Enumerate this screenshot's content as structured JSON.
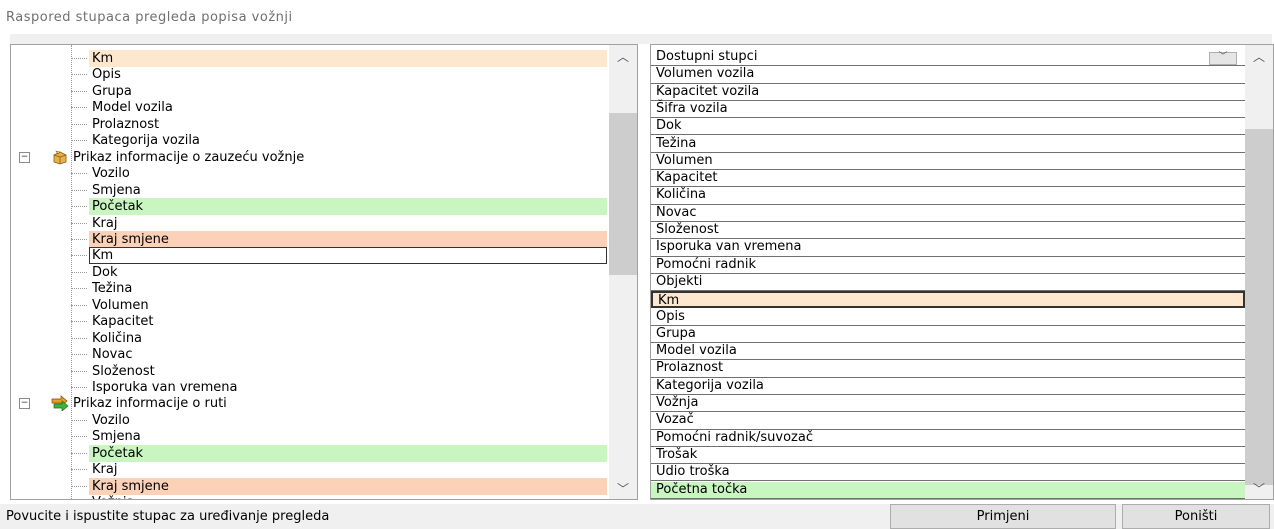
{
  "title": "Raspored stupaca pregleda popisa vožnji",
  "colors": {
    "peach": "#fde8cf",
    "salmon": "#fbd2b8",
    "green": "#c8f5c0",
    "selected_border": "#333333"
  },
  "tree": {
    "items": [
      {
        "label": "Km",
        "type": "leaf",
        "highlight": "peach"
      },
      {
        "label": "Opis",
        "type": "leaf"
      },
      {
        "label": "Grupa",
        "type": "leaf"
      },
      {
        "label": "Model vozila",
        "type": "leaf"
      },
      {
        "label": "Prolaznost",
        "type": "leaf"
      },
      {
        "label": "Kategorija vozila",
        "type": "leaf"
      },
      {
        "label": "Prikaz informacije o zauzeću vožnje",
        "type": "group",
        "icon": "package-icon",
        "expander": "−"
      },
      {
        "label": "Vozilo",
        "type": "leaf"
      },
      {
        "label": "Smjena",
        "type": "leaf"
      },
      {
        "label": "Početak",
        "type": "leaf",
        "highlight": "green"
      },
      {
        "label": "Kraj",
        "type": "leaf"
      },
      {
        "label": "Kraj smjene",
        "type": "leaf",
        "highlight": "salmon"
      },
      {
        "label": "Km",
        "type": "leaf",
        "selected": true
      },
      {
        "label": "Dok",
        "type": "leaf"
      },
      {
        "label": "Težina",
        "type": "leaf"
      },
      {
        "label": "Volumen",
        "type": "leaf"
      },
      {
        "label": "Kapacitet",
        "type": "leaf"
      },
      {
        "label": "Količina",
        "type": "leaf"
      },
      {
        "label": "Novac",
        "type": "leaf"
      },
      {
        "label": "Složenost",
        "type": "leaf"
      },
      {
        "label": "Isporuka van vremena",
        "type": "leaf"
      },
      {
        "label": "Prikaz informacije o ruti",
        "type": "group",
        "icon": "route-arrow-icon",
        "expander": "−"
      },
      {
        "label": "Vozilo",
        "type": "leaf"
      },
      {
        "label": "Smjena",
        "type": "leaf"
      },
      {
        "label": "Početak",
        "type": "leaf",
        "highlight": "green"
      },
      {
        "label": "Kraj",
        "type": "leaf"
      },
      {
        "label": "Kraj smjene",
        "type": "leaf",
        "highlight": "salmon"
      },
      {
        "label": "Vožnja",
        "type": "leaf"
      }
    ]
  },
  "columns": {
    "items": [
      {
        "label": "Dostupni stupci",
        "header": true
      },
      {
        "label": "Volumen vozila"
      },
      {
        "label": "Kapacitet vozila"
      },
      {
        "label": "Šifra vozila"
      },
      {
        "label": "Dok"
      },
      {
        "label": "Težina"
      },
      {
        "label": "Volumen"
      },
      {
        "label": "Kapacitet"
      },
      {
        "label": "Količina"
      },
      {
        "label": "Novac"
      },
      {
        "label": "Složenost"
      },
      {
        "label": "Isporuka van vremena"
      },
      {
        "label": "Pomoćni radnik"
      },
      {
        "label": "Objekti"
      },
      {
        "label": "Km",
        "highlight": "peach",
        "selected": true
      },
      {
        "label": "Opis"
      },
      {
        "label": "Grupa"
      },
      {
        "label": "Model vozila"
      },
      {
        "label": "Prolaznost"
      },
      {
        "label": "Kategorija vozila"
      },
      {
        "label": "Vožnja"
      },
      {
        "label": "Vozač"
      },
      {
        "label": "Pomoćni radnik/suvozač"
      },
      {
        "label": "Trošak"
      },
      {
        "label": "Udio troška"
      },
      {
        "label": "Početna točka",
        "highlight": "green"
      }
    ]
  },
  "status": {
    "message": "Povucite i ispustite stupac za uređivanje pregleda"
  },
  "buttons": {
    "apply": "Primjeni",
    "cancel": "Poništi"
  }
}
